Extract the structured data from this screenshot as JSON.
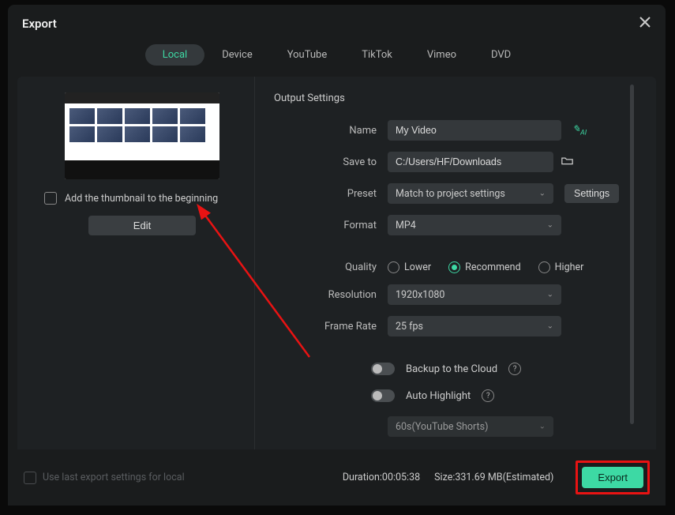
{
  "title": "Export",
  "tabs": [
    "Local",
    "Device",
    "YouTube",
    "TikTok",
    "Vimeo",
    "DVD"
  ],
  "activeTab": 0,
  "left": {
    "addThumb": "Add the thumbnail to the beginning",
    "editBtn": "Edit"
  },
  "output": {
    "heading": "Output Settings",
    "labels": {
      "name": "Name",
      "saveto": "Save to",
      "preset": "Preset",
      "format": "Format",
      "quality": "Quality",
      "resolution": "Resolution",
      "framerate": "Frame Rate"
    },
    "name": "My Video",
    "saveto": "C:/Users/HF/Downloads",
    "preset": "Match to project settings",
    "settingsBtn": "Settings",
    "format": "MP4",
    "quality": {
      "options": [
        "Lower",
        "Recommend",
        "Higher"
      ],
      "selected": 1
    },
    "resolution": "1920x1080",
    "framerate": "25 fps",
    "backup": "Backup to the Cloud",
    "autohighlight": "Auto Highlight",
    "hlpreset": "60s(YouTube Shorts)"
  },
  "footer": {
    "uselast": "Use last export settings for local",
    "duration": "Duration:00:05:38",
    "size": "Size:331.69 MB(Estimated)",
    "exportBtn": "Export"
  }
}
